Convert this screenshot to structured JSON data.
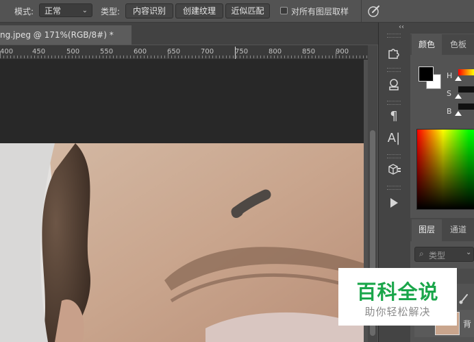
{
  "options_bar": {
    "mode_label": "模式:",
    "mode_value": "正常",
    "type_label": "类型:",
    "type_buttons": [
      "内容识别",
      "创建纹理",
      "近似匹配"
    ],
    "sample_all_layers_label": "对所有图层取样",
    "sample_all_layers_checked": false
  },
  "document": {
    "tab_title": "ng.jpeg @ 171%(RGB/8#) *"
  },
  "ruler": {
    "labels": [
      "400",
      "450",
      "500",
      "550",
      "600",
      "650",
      "700",
      "750",
      "800",
      "850",
      "900"
    ]
  },
  "tools": {
    "collapse_label": "‹‹",
    "items": [
      "puzzle-icon",
      "stamp-icon",
      "paragraph-icon",
      "character-icon",
      "3d-cube-icon",
      "play-icon"
    ]
  },
  "color_panel": {
    "tabs": [
      "颜色",
      "色板"
    ],
    "active_tab": "颜色",
    "foreground": "#000000",
    "background": "#ffffff",
    "sliders": [
      "H",
      "S",
      "B"
    ]
  },
  "layers_panel": {
    "tabs": [
      "图层",
      "通道"
    ],
    "active_tab": "图层",
    "filter_placeholder": "类型",
    "layer_name": "背"
  },
  "watermark": {
    "title": "百科全说",
    "subtitle": "助你轻松解决",
    "color": "#1aa64a"
  }
}
